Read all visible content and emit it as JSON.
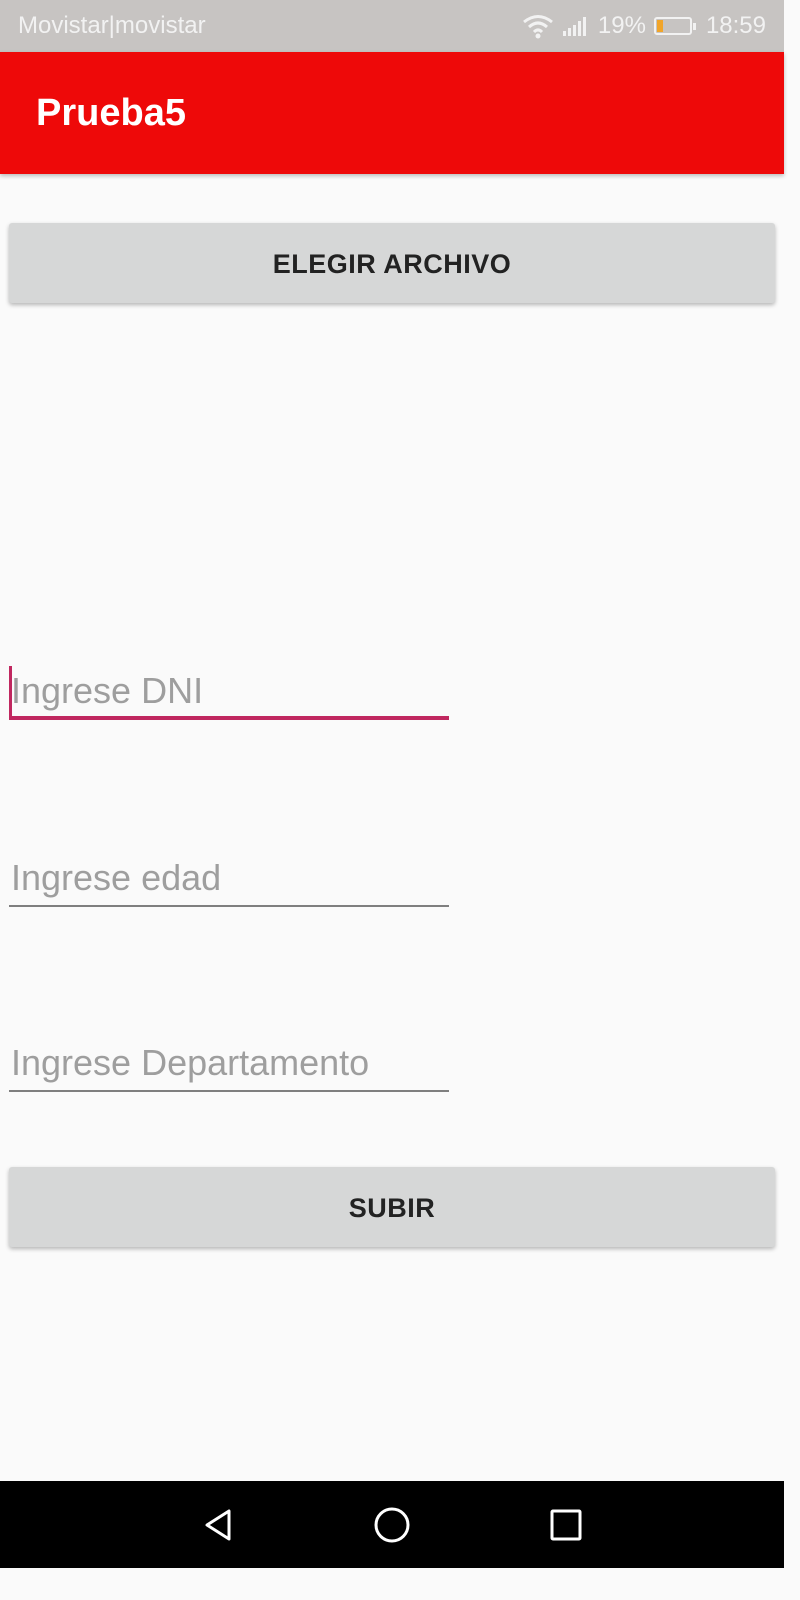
{
  "status_bar": {
    "carrier": "Movistar|movistar",
    "battery_percent": "19%",
    "battery_level": 0.19,
    "time": "18:59",
    "icons": [
      "wifi-icon",
      "signal-icon",
      "battery-icon"
    ]
  },
  "app_bar": {
    "title": "Prueba5",
    "color": "#ee0909"
  },
  "form": {
    "choose_file_label": "ELEGIR ARCHIVO",
    "dni_placeholder": "Ingrese DNI",
    "dni_value": "",
    "age_placeholder": "Ingrese edad",
    "age_value": "",
    "department_placeholder": "Ingrese Departamento",
    "department_value": "",
    "upload_label": "SUBIR",
    "focus_color": "#c0275f"
  },
  "nav_bar": {
    "icons": [
      "back-icon",
      "home-icon",
      "recent-apps-icon"
    ]
  }
}
